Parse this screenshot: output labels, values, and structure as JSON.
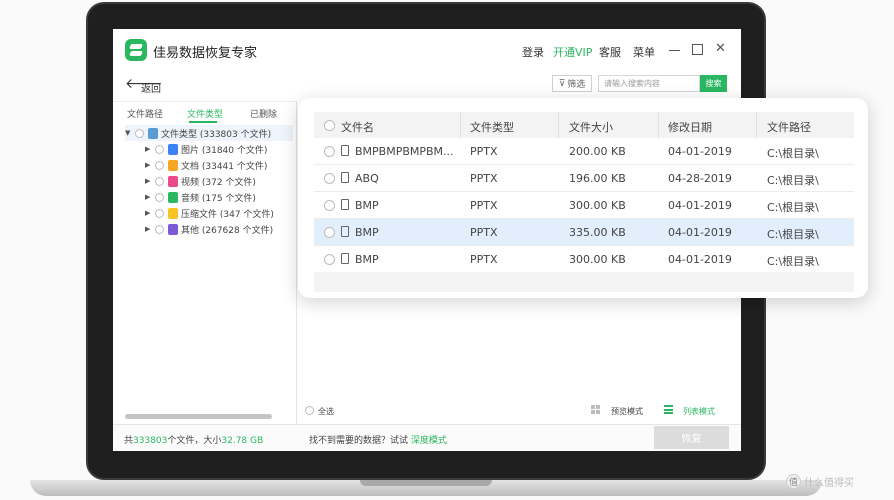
{
  "app": {
    "title": "佳易数据恢复专家",
    "login": "登录",
    "vip": "开通VIP",
    "service": "客服",
    "menu": "菜单",
    "min_icon": "minimize-icon",
    "max_icon": "maximize-icon",
    "close_glyph": "✕"
  },
  "toolbar": {
    "back_glyph": "🡐",
    "back_label": "返回",
    "filter_label": "筛选",
    "search_placeholder": "请输入搜索内容",
    "search_button": "搜索"
  },
  "sidebar": {
    "tabs": [
      "文件路径",
      "文件类型",
      "已删除"
    ],
    "active_tab": "文件类型",
    "root": {
      "label": "文件类型 (333803 个文件)"
    },
    "items": [
      {
        "label": "图片 (31840 个文件)",
        "color": "#3b82f6",
        "icon": "image-icon"
      },
      {
        "label": "文档 (33441 个文件)",
        "color": "#f5a623",
        "icon": "document-icon"
      },
      {
        "label": "视频 (372 个文件)",
        "color": "#e94b8a",
        "icon": "video-icon"
      },
      {
        "label": "音频 (175 个文件)",
        "color": "#2bb761",
        "icon": "audio-icon"
      },
      {
        "label": "压缩文件 (347 个文件)",
        "color": "#f7c325",
        "icon": "archive-icon"
      },
      {
        "label": "其他 (267628 个文件)",
        "color": "#7b5cd6",
        "icon": "other-icon"
      }
    ]
  },
  "table": {
    "columns": [
      "文件名",
      "文件类型",
      "文件大小",
      "修改日期",
      "文件路径"
    ],
    "rows": [
      {
        "name": "BMPBMPBMPBM...",
        "type": "PPTX",
        "size": "200.00 KB",
        "date": "04-01-2019",
        "path": "C:\\根目录\\"
      },
      {
        "name": "ABQ",
        "type": "PPTX",
        "size": "196.00 KB",
        "date": "04-28-2019",
        "path": "C:\\根目录\\"
      },
      {
        "name": "BMP",
        "type": "PPTX",
        "size": "300.00 KB",
        "date": "04-01-2019",
        "path": "C:\\根目录\\"
      },
      {
        "name": "BMP",
        "type": "PPTX",
        "size": "335.00 KB",
        "date": "04-01-2019",
        "path": "C:\\根目录\\",
        "selected": true
      },
      {
        "name": "BMP",
        "type": "PPTX",
        "size": "300.00 KB",
        "date": "04-01-2019",
        "path": "C:\\根目录\\"
      }
    ]
  },
  "view": {
    "select_all": "全选",
    "preview_mode": "预览模式",
    "list_mode": "列表模式"
  },
  "footer": {
    "status_prefix": "共",
    "file_count": "333803",
    "status_mid": "个文件，大小",
    "total_size": "32.78 GB",
    "not_found": "找不到需要的数据？试试",
    "deep_mode": "深度模式",
    "recover": "恢复"
  },
  "watermark": {
    "glyph": "值",
    "text": "什么值得买"
  },
  "colors": {
    "accent": "#2bb761",
    "selected_row": "#e2eefb"
  }
}
